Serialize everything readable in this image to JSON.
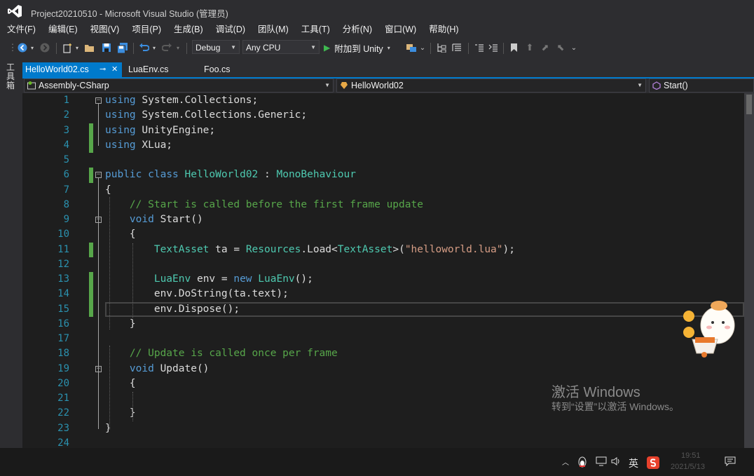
{
  "window": {
    "title": "Project20210510 - Microsoft Visual Studio (管理员)"
  },
  "menu": [
    {
      "label": "文件(F)"
    },
    {
      "label": "编辑(E)"
    },
    {
      "label": "视图(V)"
    },
    {
      "label": "项目(P)"
    },
    {
      "label": "生成(B)"
    },
    {
      "label": "调试(D)"
    },
    {
      "label": "团队(M)"
    },
    {
      "label": "工具(T)"
    },
    {
      "label": "分析(N)"
    },
    {
      "label": "窗口(W)"
    },
    {
      "label": "帮助(H)"
    }
  ],
  "toolbar": {
    "config": "Debug",
    "platform": "Any CPU",
    "attach_label": "附加到 Unity"
  },
  "toolstrip": {
    "toolbox_label": "工具箱"
  },
  "tabs": [
    {
      "label": "HelloWorld02.cs",
      "pin": "⊸",
      "close": "✕",
      "active": true
    },
    {
      "label": "LuaEnv.cs"
    },
    {
      "label": "Foo.cs"
    }
  ],
  "navbar": {
    "project": "Assembly-CSharp",
    "type": "HelloWorld02",
    "member": "Start()"
  },
  "editor": {
    "line_numbers": [
      "1",
      "2",
      "3",
      "4",
      "5",
      "6",
      "7",
      "8",
      "9",
      "10",
      "11",
      "12",
      "13",
      "14",
      "15",
      "16",
      "17",
      "18",
      "19",
      "20",
      "21",
      "22",
      "23",
      "24"
    ],
    "lines": [
      {
        "segments": [
          {
            "t": "using",
            "c": "kw"
          },
          {
            "t": " System.Collections;",
            "c": ""
          }
        ]
      },
      {
        "segments": [
          {
            "t": "using",
            "c": "kw"
          },
          {
            "t": " System.Collections.Generic;",
            "c": ""
          }
        ]
      },
      {
        "segments": [
          {
            "t": "using",
            "c": "kw"
          },
          {
            "t": " UnityEngine;",
            "c": ""
          }
        ]
      },
      {
        "segments": [
          {
            "t": "using",
            "c": "kw"
          },
          {
            "t": " XLua;",
            "c": ""
          }
        ]
      },
      {
        "segments": []
      },
      {
        "segments": [
          {
            "t": "public",
            "c": "kw"
          },
          {
            "t": " ",
            "c": ""
          },
          {
            "t": "class",
            "c": "kw"
          },
          {
            "t": " ",
            "c": ""
          },
          {
            "t": "HelloWorld02",
            "c": "ty"
          },
          {
            "t": " : ",
            "c": ""
          },
          {
            "t": "MonoBehaviour",
            "c": "ty"
          }
        ]
      },
      {
        "segments": [
          {
            "t": "{",
            "c": ""
          }
        ]
      },
      {
        "segments": [
          {
            "t": "    ",
            "c": ""
          },
          {
            "t": "// Start is called before the first frame update",
            "c": "cm"
          }
        ]
      },
      {
        "segments": [
          {
            "t": "    ",
            "c": ""
          },
          {
            "t": "void",
            "c": "kw"
          },
          {
            "t": " Start()",
            "c": ""
          }
        ]
      },
      {
        "segments": [
          {
            "t": "    {",
            "c": ""
          }
        ]
      },
      {
        "segments": [
          {
            "t": "        ",
            "c": ""
          },
          {
            "t": "TextAsset",
            "c": "ty"
          },
          {
            "t": " ta = ",
            "c": ""
          },
          {
            "t": "Resources",
            "c": "ty"
          },
          {
            "t": ".Load<",
            "c": ""
          },
          {
            "t": "TextAsset",
            "c": "ty"
          },
          {
            "t": ">(",
            "c": ""
          },
          {
            "t": "\"helloworld.lua\"",
            "c": "st"
          },
          {
            "t": ");",
            "c": ""
          }
        ]
      },
      {
        "segments": []
      },
      {
        "segments": [
          {
            "t": "        ",
            "c": ""
          },
          {
            "t": "LuaEnv",
            "c": "ty"
          },
          {
            "t": " env = ",
            "c": ""
          },
          {
            "t": "new",
            "c": "kw"
          },
          {
            "t": " ",
            "c": ""
          },
          {
            "t": "LuaEnv",
            "c": "ty"
          },
          {
            "t": "();",
            "c": ""
          }
        ]
      },
      {
        "segments": [
          {
            "t": "        env.DoString(ta.text);",
            "c": ""
          }
        ]
      },
      {
        "segments": [
          {
            "t": "        env.Dispose();",
            "c": ""
          }
        ]
      },
      {
        "segments": [
          {
            "t": "    }",
            "c": ""
          }
        ]
      },
      {
        "segments": []
      },
      {
        "segments": [
          {
            "t": "    ",
            "c": ""
          },
          {
            "t": "// Update is called once per frame",
            "c": "cm"
          }
        ]
      },
      {
        "segments": [
          {
            "t": "    ",
            "c": ""
          },
          {
            "t": "void",
            "c": "kw"
          },
          {
            "t": " Update()",
            "c": ""
          }
        ]
      },
      {
        "segments": [
          {
            "t": "    {",
            "c": ""
          }
        ]
      },
      {
        "segments": []
      },
      {
        "segments": [
          {
            "t": "    }",
            "c": ""
          }
        ]
      },
      {
        "segments": [
          {
            "t": "}",
            "c": ""
          }
        ]
      },
      {
        "segments": []
      }
    ],
    "changed_lines": [
      3,
      4,
      6,
      11,
      13,
      14,
      15
    ],
    "fold_markers": [
      1,
      6,
      9,
      19
    ]
  },
  "watermark": {
    "title": "激活 Windows",
    "subtitle": "转到“设置”以激活 Windows。"
  },
  "taskbar": {
    "ime": "英",
    "time": "19:51",
    "date": "2021/5/13"
  },
  "colors": {
    "accent": "#007acc",
    "change_bar": "#57a64a",
    "line_number": "#2b91af"
  }
}
